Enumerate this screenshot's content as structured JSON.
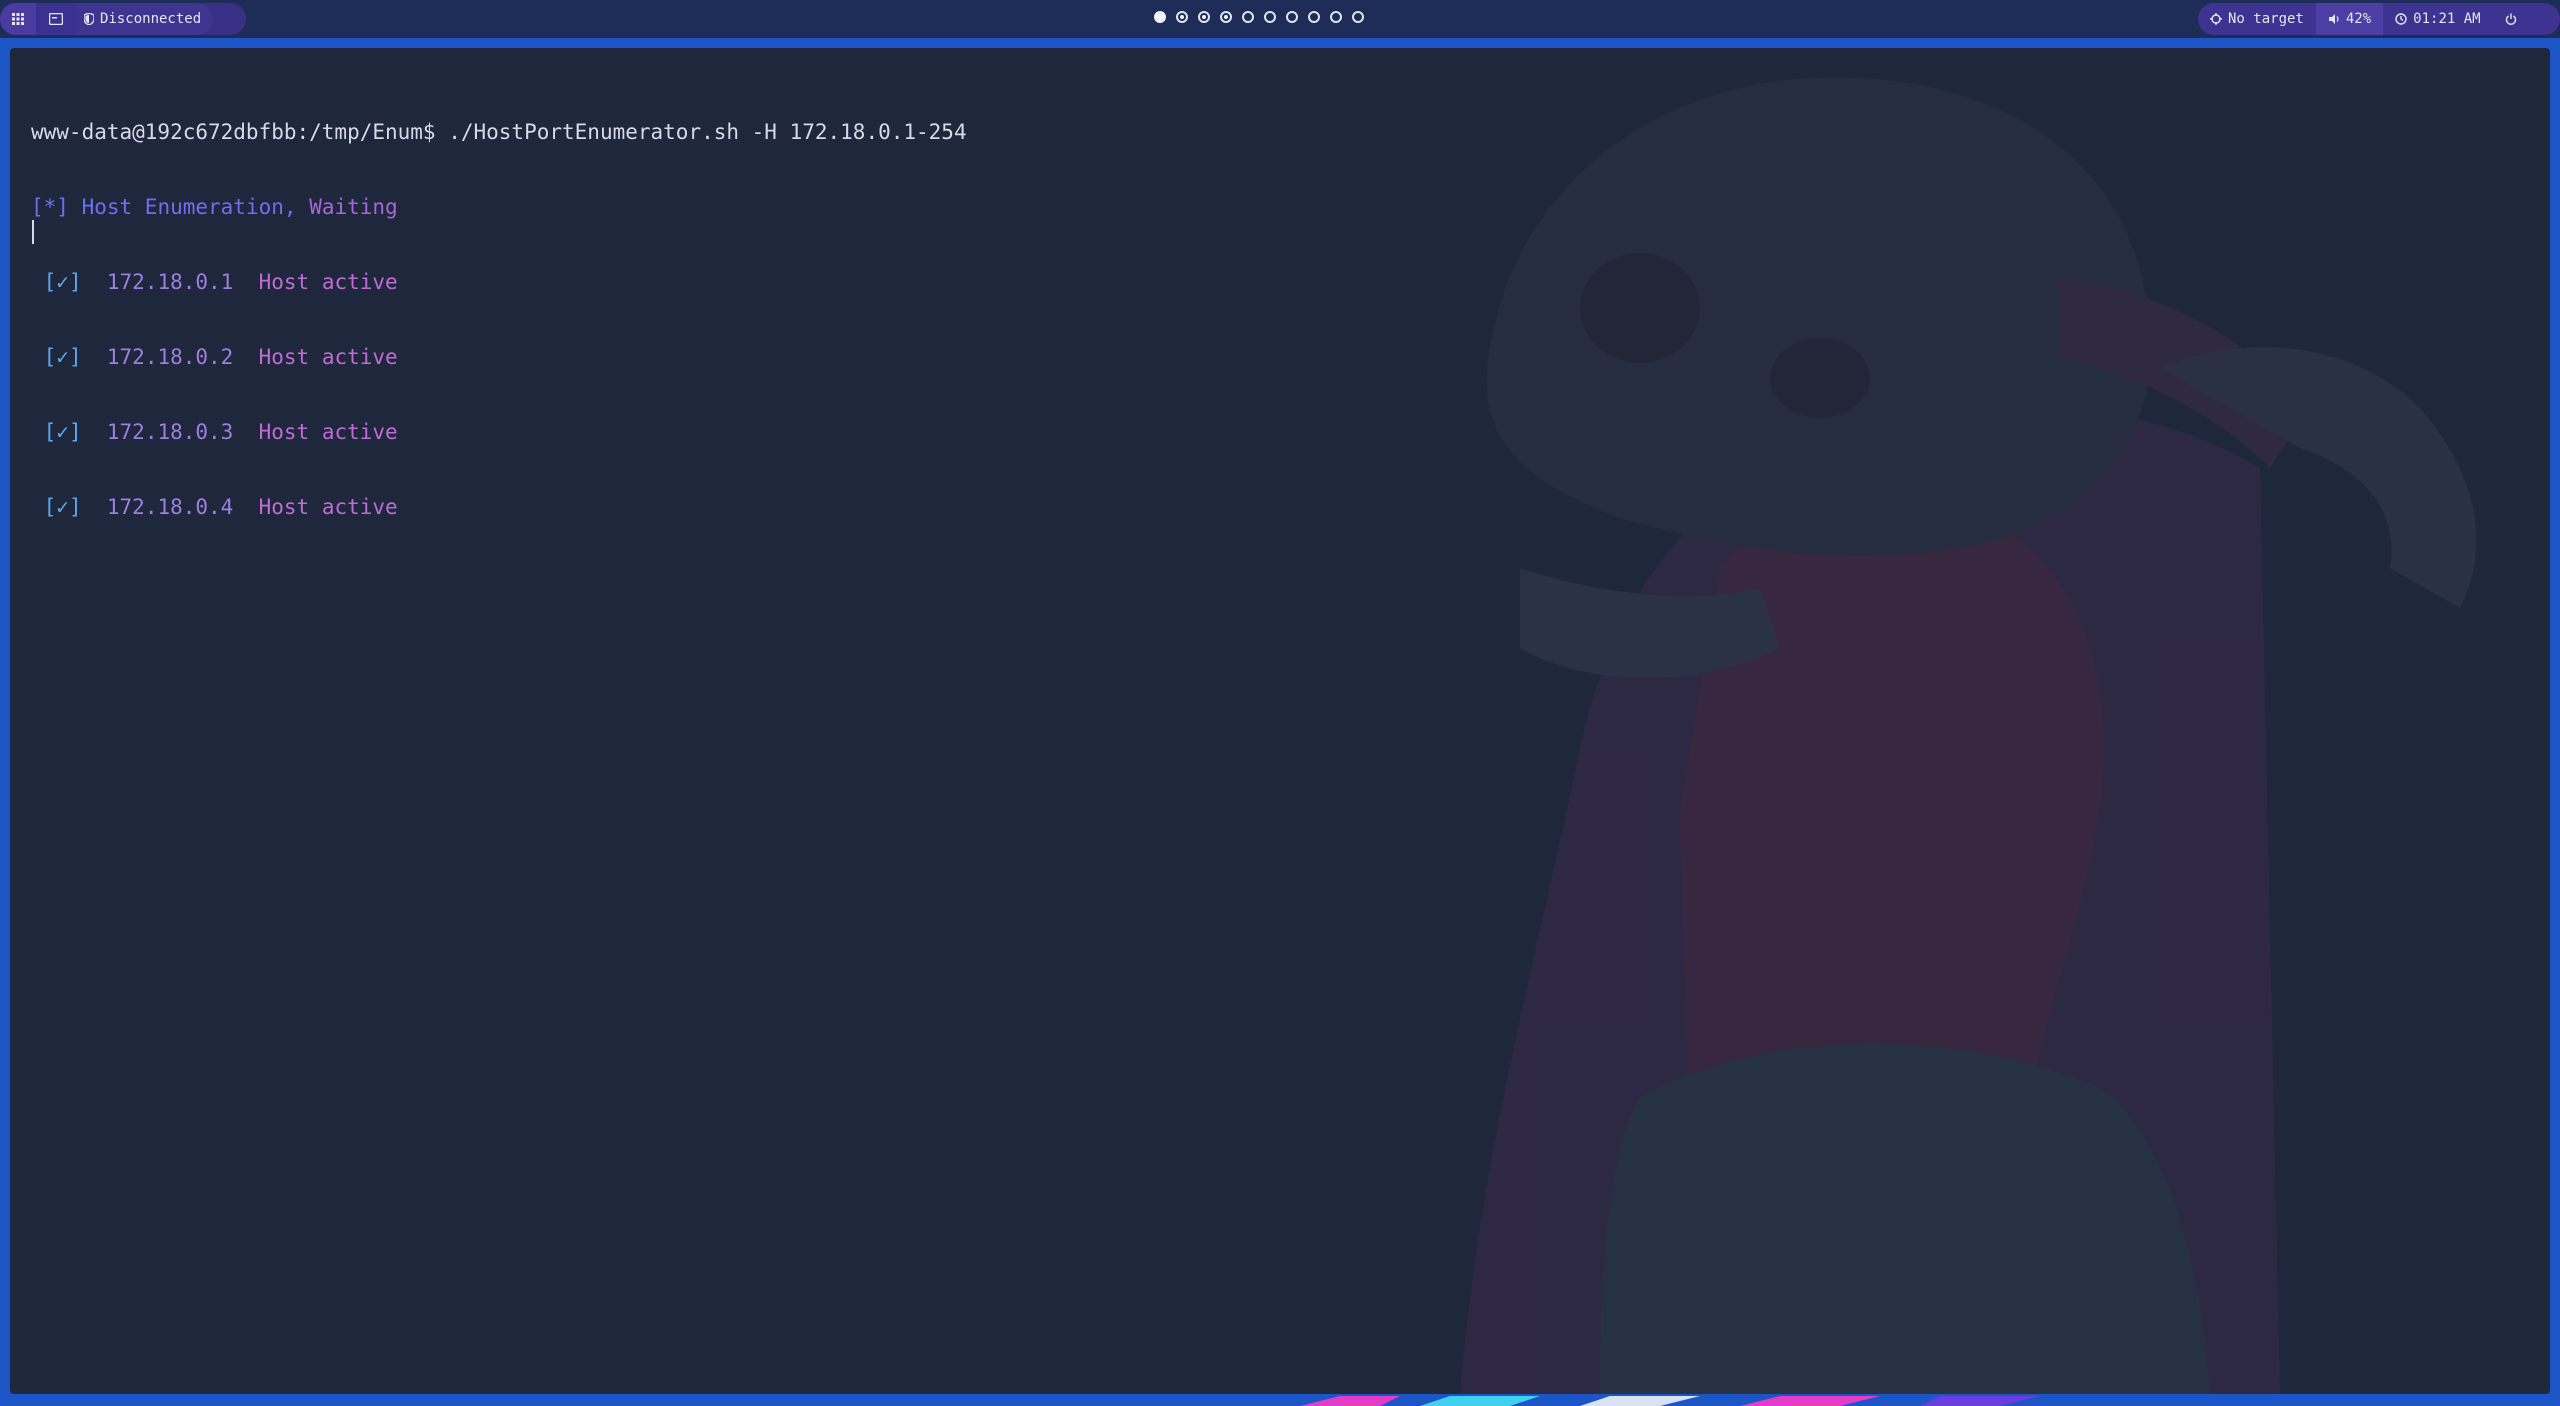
{
  "topbar": {
    "vpn_status": "Disconnected",
    "workspaces": [
      {
        "state": "active"
      },
      {
        "state": "occupied"
      },
      {
        "state": "occupied"
      },
      {
        "state": "occupied"
      },
      {
        "state": "empty"
      },
      {
        "state": "empty"
      },
      {
        "state": "empty"
      },
      {
        "state": "empty"
      },
      {
        "state": "empty"
      },
      {
        "state": "empty"
      }
    ],
    "target": "No target",
    "volume": "42%",
    "time": "01:21 AM"
  },
  "terminal": {
    "prompt": "www-data@192c672dbfbb:/tmp/Enum$ ./HostPortEnumerator.sh -H 172.18.0.1-254",
    "info_marker": "[*]",
    "info_text_1": "Host Enumeration,",
    "info_text_2": "Waiting",
    "hosts": [
      {
        "mark": "[✓]",
        "ip": "172.18.0.1",
        "status": "Host active"
      },
      {
        "mark": "[✓]",
        "ip": "172.18.0.2",
        "status": "Host active"
      },
      {
        "mark": "[✓]",
        "ip": "172.18.0.3",
        "status": "Host active"
      },
      {
        "mark": "[✓]",
        "ip": "172.18.0.4",
        "status": "Host active"
      }
    ]
  },
  "colors": {
    "desktop": "#1c56c6",
    "bar": "#1d2d57",
    "pill": "#3f3392",
    "terminal_bg": "#1f273c",
    "info": "#6b6ff0",
    "check": "#5aa9f0",
    "ip": "#9d7ee0",
    "status": "#c06ad6"
  }
}
